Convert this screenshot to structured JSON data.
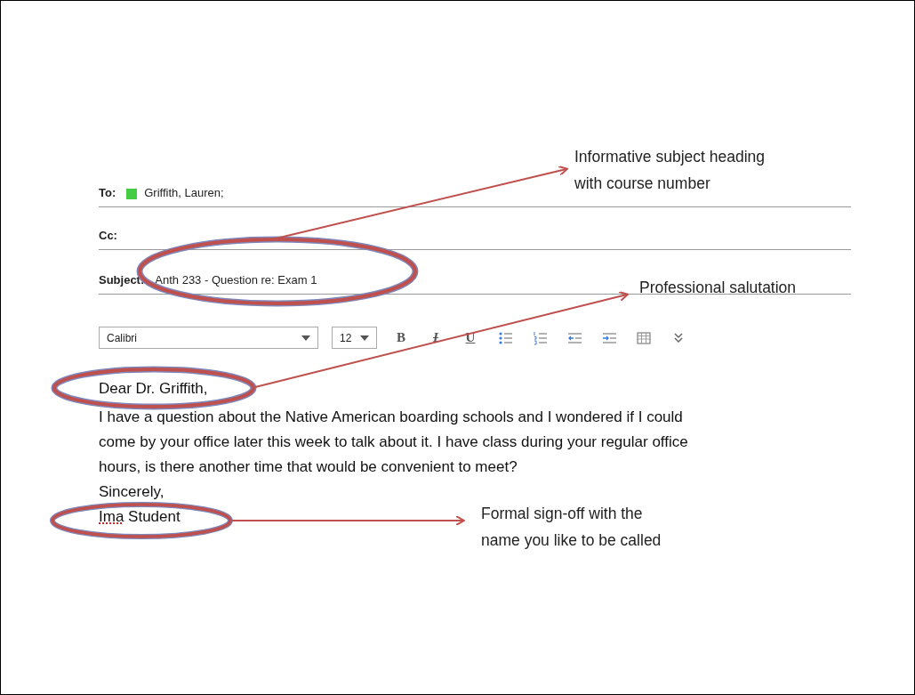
{
  "header_fields": [
    {
      "label": "To:",
      "recipients": [
        {
          "name": "Griffith, Lauren;",
          "color": "#44cc44"
        }
      ]
    },
    {
      "label": "Cc:"
    },
    {
      "label": "Subject:",
      "value": "Anth 233 - Question re: Exam 1"
    }
  ],
  "toolbar": {
    "font": "Calibri",
    "size": "12",
    "buttons": [
      {
        "kind": "text",
        "label": "B"
      },
      {
        "kind": "strike",
        "label": "I"
      },
      {
        "kind": "underline",
        "label": "U"
      },
      {
        "kind": "bullets"
      },
      {
        "kind": "numbering"
      },
      {
        "kind": "outdent"
      },
      {
        "kind": "indent"
      },
      {
        "kind": "table"
      },
      {
        "kind": "more"
      }
    ]
  },
  "body": {
    "salutation": "Dear Dr. Griffith,",
    "paragraph_lines": [
      "I have a question about the Native American boarding schools and I wondered if I could",
      "come by your office later this week to talk about it. I have class during your regular office",
      "hours, is there another time that would be convenient to meet?"
    ],
    "closing": "Sincerely,",
    "signature": [
      {
        "text": "Ima",
        "misspelled": true
      },
      {
        "text": "Student",
        "misspelled": false
      }
    ]
  },
  "annotations": [
    {
      "lines": [
        "Informative subject heading",
        "with course number"
      ]
    },
    {
      "lines": [
        "Professional salutation"
      ]
    },
    {
      "lines": [
        "Formal sign-off with the",
        "name you like to be called"
      ]
    }
  ]
}
